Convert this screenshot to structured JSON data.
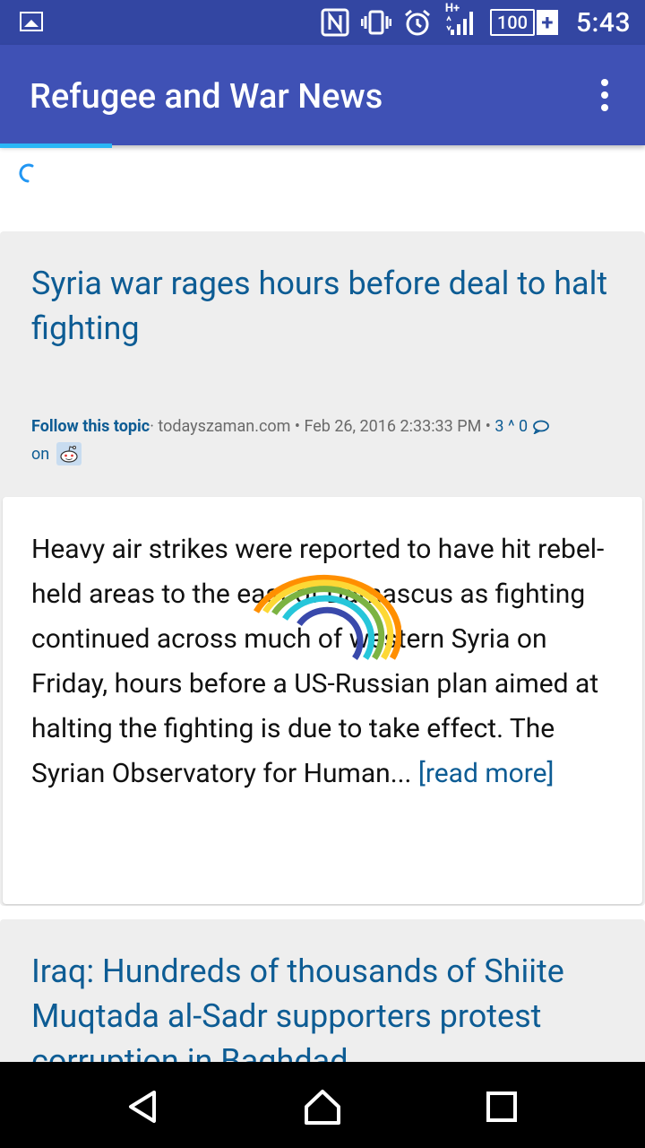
{
  "status_bar": {
    "icons": [
      "image-icon",
      "nfc-icon",
      "vibrate-icon",
      "alarm-icon",
      "signal-icon"
    ],
    "network_label": "H+",
    "battery_level": "100",
    "battery_plus": "+",
    "time": "5:43"
  },
  "app_bar": {
    "title": "Refugee and War News",
    "overflow_icon": "more-vert-icon"
  },
  "articles": [
    {
      "title": "Syria war rages hours before deal to halt fighting",
      "follow_label": "Follow this topic",
      "source": "todayszaman.com",
      "date": "Feb 26, 2016 2:33:33 PM",
      "upvotes": "3",
      "comments": "0",
      "on_label": "on",
      "summary": "Heavy air strikes were reported to have hit rebel-held areas to the east of Damascus as fighting continued across much of western Syria on Friday, hours before a US-Russian plan aimed at halting the fighting is due to take effect. The Syrian Observatory for Human...",
      "read_more": "[read more]"
    },
    {
      "title": "Iraq: Hundreds of thousands of Shiite Muqtada al-Sadr supporters protest corruption in Baghdad"
    }
  ],
  "colors": {
    "status_bar": "#3346a2",
    "app_bar": "#3f51b5",
    "link": "#0d5c94",
    "card_bg": "#eeeeee"
  }
}
